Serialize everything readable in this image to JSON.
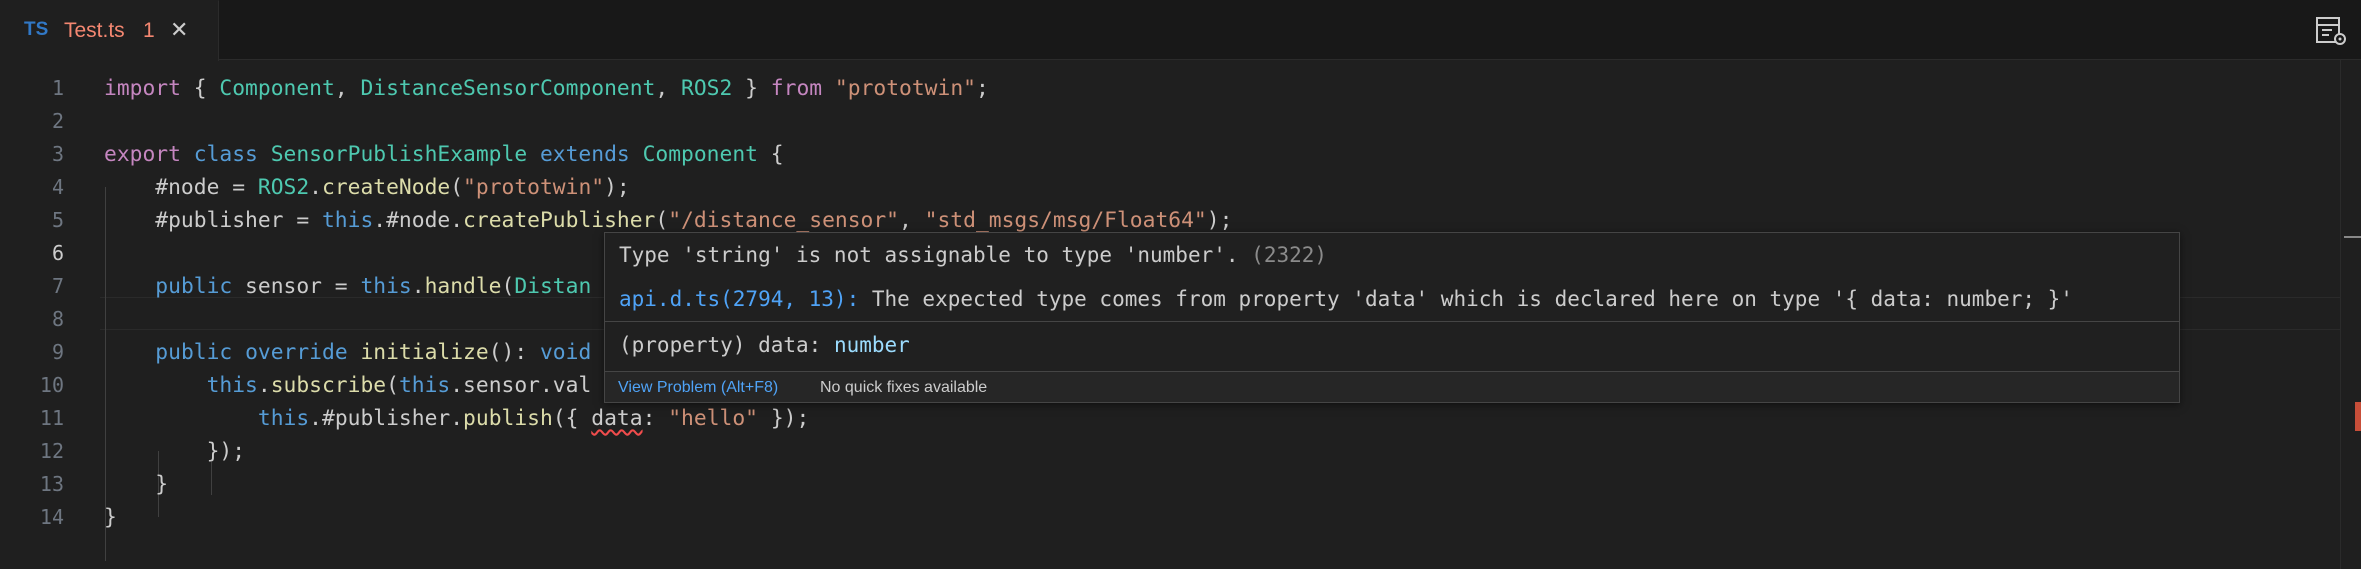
{
  "tab": {
    "lang": "TS",
    "filename": "Test.ts",
    "problem_count": "1",
    "close_glyph": "✕"
  },
  "toolbar": {
    "icon": "layout-settings-icon"
  },
  "editor": {
    "line_numbers": [
      "1",
      "2",
      "3",
      "4",
      "5",
      "6",
      "7",
      "8",
      "9",
      "10",
      "11",
      "12",
      "13",
      "14"
    ],
    "lines": [
      {
        "tokens": [
          [
            "kw",
            "import"
          ],
          [
            "plain",
            " { "
          ],
          [
            "cls",
            "Component"
          ],
          [
            "plain",
            ", "
          ],
          [
            "cls",
            "DistanceSensorComponent"
          ],
          [
            "plain",
            ", "
          ],
          [
            "cls",
            "ROS2"
          ],
          [
            "plain",
            " } "
          ],
          [
            "kw",
            "from"
          ],
          [
            "plain",
            " "
          ],
          [
            "str",
            "\"prototwin\""
          ],
          [
            "plain",
            ";"
          ]
        ]
      },
      {
        "tokens": []
      },
      {
        "tokens": [
          [
            "kw",
            "export"
          ],
          [
            "plain",
            " "
          ],
          [
            "kwb",
            "class"
          ],
          [
            "plain",
            " "
          ],
          [
            "cls",
            "SensorPublishExample"
          ],
          [
            "plain",
            " "
          ],
          [
            "kwb",
            "extends"
          ],
          [
            "plain",
            " "
          ],
          [
            "cls",
            "Component"
          ],
          [
            "plain",
            " {"
          ]
        ]
      },
      {
        "tokens": [
          [
            "plain",
            "    #node = "
          ],
          [
            "cls",
            "ROS2"
          ],
          [
            "plain",
            "."
          ],
          [
            "fn",
            "createNode"
          ],
          [
            "plain",
            "("
          ],
          [
            "str",
            "\"prototwin\""
          ],
          [
            "plain",
            ");"
          ]
        ]
      },
      {
        "tokens": [
          [
            "plain",
            "    #publisher = "
          ],
          [
            "kwb",
            "this"
          ],
          [
            "plain",
            ".#node."
          ],
          [
            "fn",
            "createPublisher"
          ],
          [
            "plain",
            "("
          ],
          [
            "str",
            "\"/distance_sensor\""
          ],
          [
            "plain",
            ", "
          ],
          [
            "str",
            "\"std_msgs/msg/Float64\""
          ],
          [
            "plain",
            ");"
          ]
        ]
      },
      {
        "tokens": []
      },
      {
        "tokens": [
          [
            "plain",
            "    "
          ],
          [
            "kwb",
            "public"
          ],
          [
            "plain",
            " sensor = "
          ],
          [
            "kwb",
            "this"
          ],
          [
            "plain",
            "."
          ],
          [
            "fn",
            "handle"
          ],
          [
            "plain",
            "("
          ],
          [
            "cls",
            "Distan"
          ]
        ]
      },
      {
        "tokens": []
      },
      {
        "tokens": [
          [
            "plain",
            "    "
          ],
          [
            "kwb",
            "public"
          ],
          [
            "plain",
            " "
          ],
          [
            "kwb",
            "override"
          ],
          [
            "plain",
            " "
          ],
          [
            "fn",
            "initialize"
          ],
          [
            "plain",
            "(): "
          ],
          [
            "kwb",
            "void"
          ]
        ]
      },
      {
        "tokens": [
          [
            "plain",
            "        "
          ],
          [
            "kwb",
            "this"
          ],
          [
            "plain",
            "."
          ],
          [
            "fn",
            "subscribe"
          ],
          [
            "plain",
            "("
          ],
          [
            "kwb",
            "this"
          ],
          [
            "plain",
            ".sensor.val"
          ]
        ]
      },
      {
        "tokens": [
          [
            "plain",
            "            "
          ],
          [
            "kwb",
            "this"
          ],
          [
            "plain",
            ".#publisher."
          ],
          [
            "fn",
            "publish"
          ],
          [
            "plain",
            "({ "
          ],
          [
            "squig",
            "data"
          ],
          [
            "plain",
            ": "
          ],
          [
            "str",
            "\"hello\""
          ],
          [
            "plain",
            " });"
          ]
        ]
      },
      {
        "tokens": [
          [
            "plain",
            "        });"
          ]
        ]
      },
      {
        "tokens": [
          [
            "plain",
            "    }"
          ]
        ]
      },
      {
        "tokens": [
          [
            "plain",
            "}"
          ]
        ]
      }
    ],
    "active_line": 6
  },
  "hover": {
    "message": "Type 'string' is not assignable to type 'number'.",
    "error_code": "(2322)",
    "related_link": "api.d.ts(2794, 13):",
    "related_text": " The expected type comes from property 'data' which is declared here on type '{ data: number; }'",
    "sig_kind": "(property)",
    "sig_name": " data: ",
    "sig_type": "number",
    "view_problem": "View Problem (Alt+F8)",
    "no_fixes": "No quick fixes available"
  }
}
